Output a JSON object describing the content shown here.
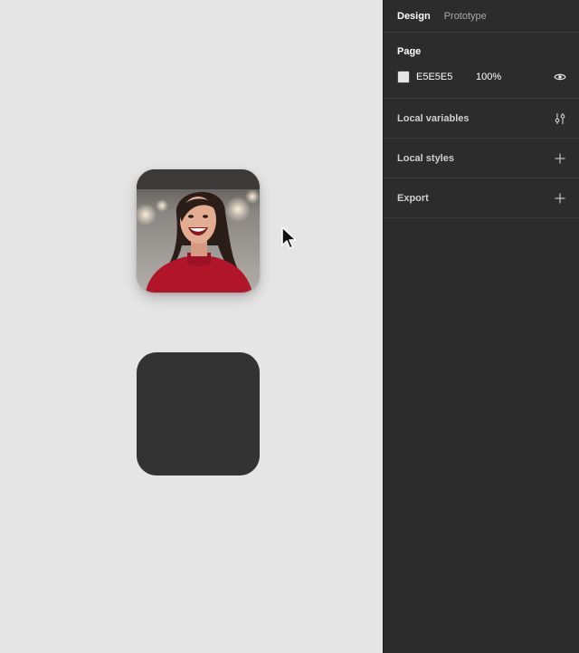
{
  "panel": {
    "tabs": [
      {
        "label": "Design",
        "active": true
      },
      {
        "label": "Prototype",
        "active": false
      }
    ],
    "page": {
      "title": "Page",
      "color_hex": "E5E5E5",
      "opacity": "100%",
      "visibility_icon": "eye-icon"
    },
    "sections": [
      {
        "label": "Local variables",
        "icon": "variables-icon"
      },
      {
        "label": "Local styles",
        "icon": "plus-icon"
      },
      {
        "label": "Export",
        "icon": "plus-icon"
      }
    ]
  },
  "canvas": {
    "background": "#e5e5e5",
    "frames": [
      {
        "kind": "photo",
        "description_icon": "portrait-photo"
      },
      {
        "kind": "placeholder",
        "fill": "#333333"
      }
    ],
    "cursor_icon": "arrow-cursor-icon"
  }
}
